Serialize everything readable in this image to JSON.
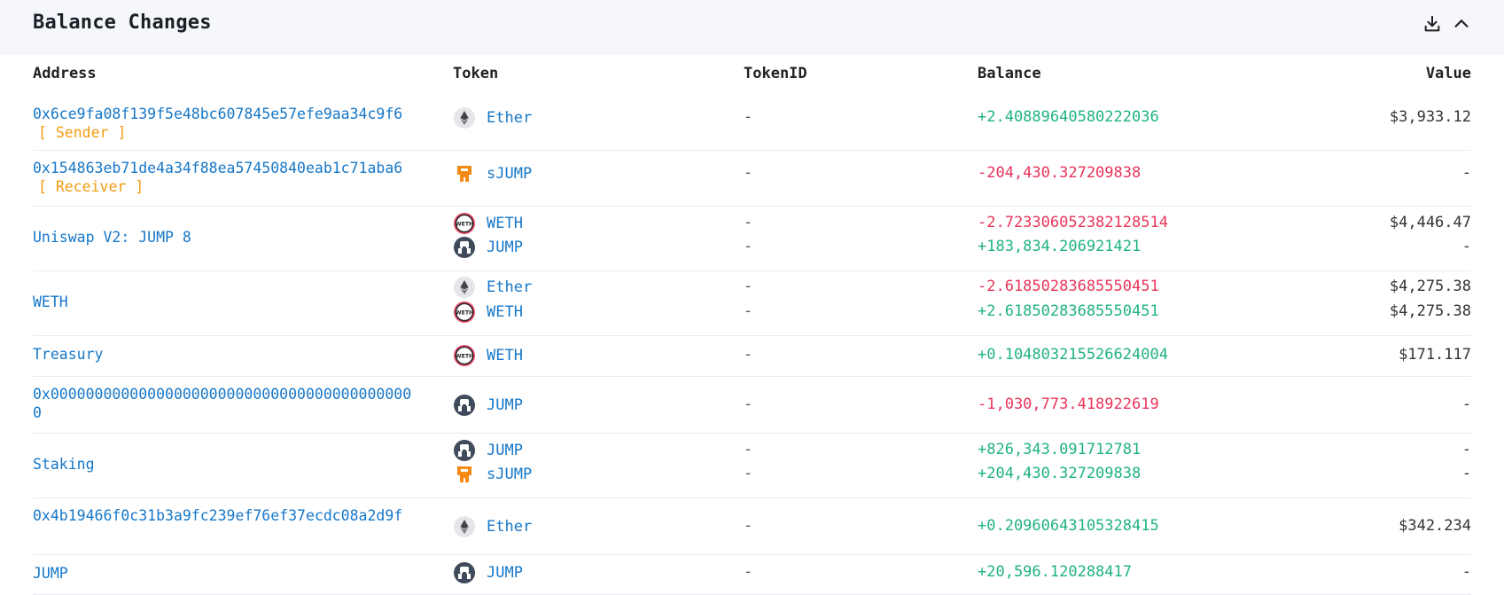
{
  "panel": {
    "title": "Balance Changes",
    "download_icon": "download-icon",
    "collapse_icon": "chevron-up-icon"
  },
  "columns": {
    "address": "Address",
    "token": "Token",
    "token_id": "TokenID",
    "balance": "Balance",
    "value": "Value"
  },
  "colors": {
    "link": "#1677c8",
    "positive": "#1fb37e",
    "negative": "#e8345a",
    "role_tag": "#f29c12",
    "header_bg": "#f5f7fa"
  },
  "rows": [
    {
      "address": "0x6ce9fa08f139f5e48bc607845e57efe9aa34c9f6",
      "role": "[ Sender ]",
      "tokens": [
        {
          "icon": "ether-icon",
          "name": "Ether",
          "token_id": "-",
          "balance": "+2.40889640580222036",
          "value": "$3,933.12"
        }
      ]
    },
    {
      "address": "0x154863eb71de4a34f88ea57450840eab1c71aba6",
      "role": "[ Receiver ]",
      "tokens": [
        {
          "icon": "sjump-icon",
          "name": "sJUMP",
          "token_id": "-",
          "balance": "-204,430.327209838",
          "value": "-"
        }
      ]
    },
    {
      "address": "Uniswap V2: JUMP 8",
      "tokens": [
        {
          "icon": "weth-icon",
          "name": "WETH",
          "token_id": "-",
          "balance": "-2.723306052382128514",
          "value": "$4,446.47"
        },
        {
          "icon": "jump-icon",
          "name": "JUMP",
          "token_id": "-",
          "balance": "+183,834.206921421",
          "value": "-"
        }
      ]
    },
    {
      "address": "WETH",
      "tokens": [
        {
          "icon": "ether-icon",
          "name": "Ether",
          "token_id": "-",
          "balance": "-2.61850283685550451",
          "value": "$4,275.38"
        },
        {
          "icon": "weth-icon",
          "name": "WETH",
          "token_id": "-",
          "balance": "+2.61850283685550451",
          "value": "$4,275.38"
        }
      ]
    },
    {
      "address": "Treasury",
      "tokens": [
        {
          "icon": "weth-icon",
          "name": "WETH",
          "token_id": "-",
          "balance": "+0.104803215526624004",
          "value": "$171.117"
        }
      ]
    },
    {
      "address": "0x000000000000000000000000000000000000000000",
      "tokens": [
        {
          "icon": "jump-icon",
          "name": "JUMP",
          "token_id": "-",
          "balance": "-1,030,773.418922619",
          "value": "-"
        }
      ]
    },
    {
      "address": "Staking",
      "tokens": [
        {
          "icon": "jump-icon",
          "name": "JUMP",
          "token_id": "-",
          "balance": "+826,343.091712781",
          "value": "-"
        },
        {
          "icon": "sjump-icon",
          "name": "sJUMP",
          "token_id": "-",
          "balance": "+204,430.327209838",
          "value": "-"
        }
      ]
    },
    {
      "address": "0x4b19466f0c31b3a9fc239ef76ef37ecdc08a2d9f",
      "tokens": [
        {
          "icon": "ether-icon",
          "name": "Ether",
          "token_id": "-",
          "balance": "+0.20960643105328415",
          "value": "$342.234"
        }
      ]
    },
    {
      "address": "JUMP",
      "tokens": [
        {
          "icon": "jump-icon",
          "name": "JUMP",
          "token_id": "-",
          "balance": "+20,596.120288417",
          "value": "-"
        }
      ]
    }
  ]
}
